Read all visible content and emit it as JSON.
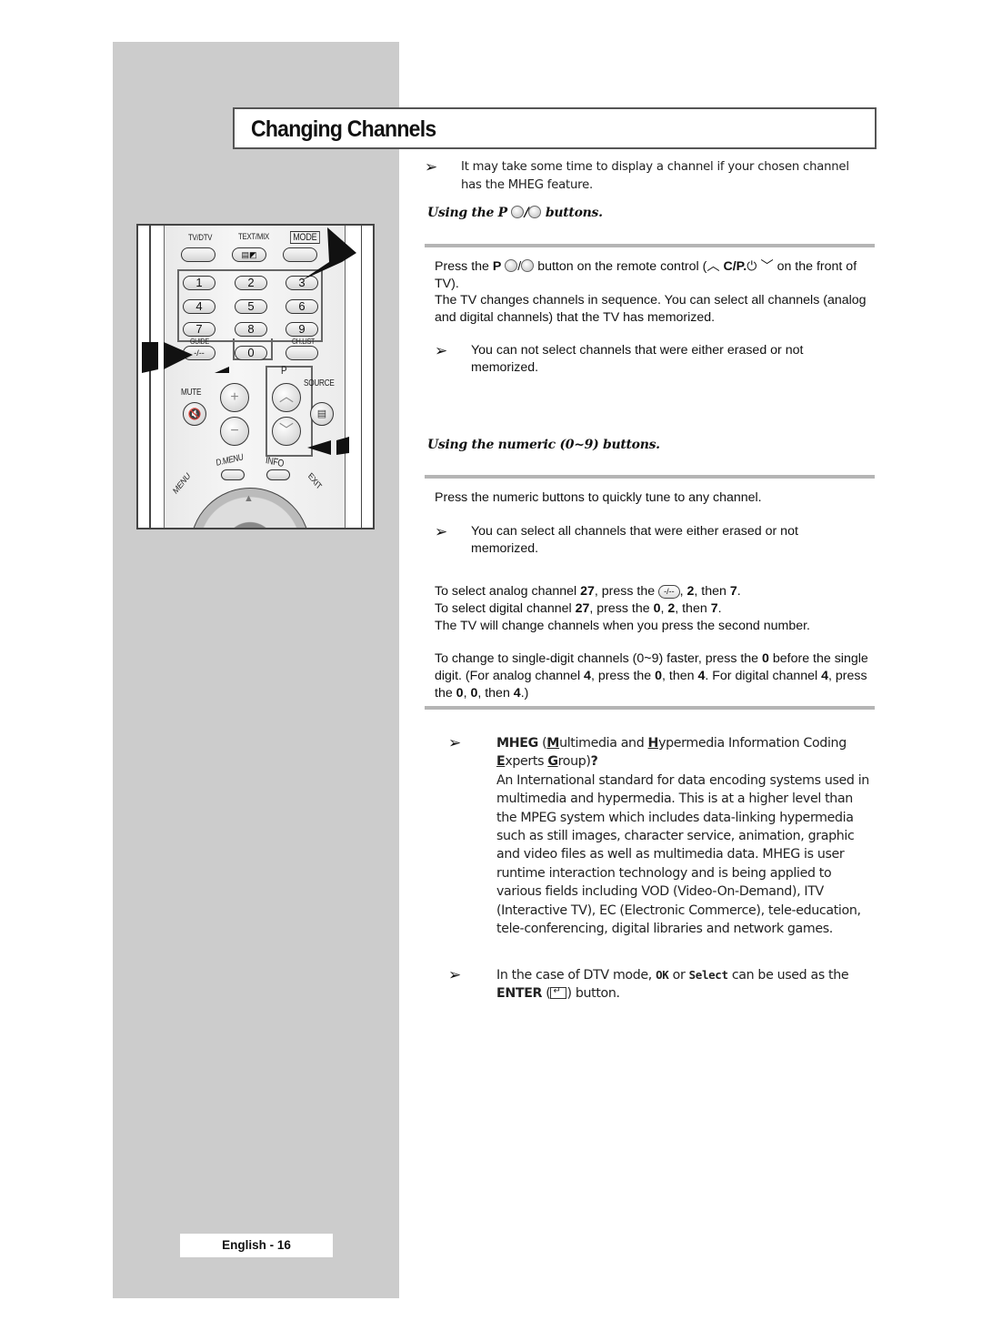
{
  "page": {
    "title": "Changing Channels",
    "footer": "English - 16"
  },
  "remote": {
    "labels": {
      "tv_dtv": "TV/DTV",
      "text_mix": "TEXT/MIX",
      "mode": "MODE",
      "guide": "GUIDE",
      "ch_list": "CH.LIST",
      "mute": "MUTE",
      "p": "P",
      "source": "SOURCE",
      "d_menu": "D.MENU",
      "info": "INFO",
      "menu": "MENU",
      "exit": "EXIT"
    },
    "numeric_keys": [
      "1",
      "2",
      "3",
      "4",
      "5",
      "6",
      "7",
      "8",
      "9"
    ],
    "zero_key": "0",
    "dash_key": "-/--",
    "vol_up": "+",
    "vol_down": "−",
    "ch_up": "︿",
    "ch_down": "﹀",
    "up_arrow": "▲"
  },
  "intro_note": "It may take some time to display a channel if your chosen channel has the MHEG feature.",
  "section1": {
    "heading_prefix": "Using the P",
    "heading_sep": "/",
    "heading_suffix": "buttons.",
    "para1_a": "Press the ",
    "para1_b": "P",
    "para1_c": "/",
    "para1_d": " button on the remote control (",
    "para1_e": "︿",
    "para1_f": " C/P.",
    "para1_g": "⏻",
    "para1_h": "﹀",
    "para1_i": " on the front of TV).",
    "para2": "The TV changes channels in sequence. You can select all channels (analog and digital channels) that the TV has memorized.",
    "note": "You can not select channels that were either erased or not memorized."
  },
  "section2": {
    "heading": "Using the numeric (0~9) buttons.",
    "para1": "Press the numeric buttons to quickly tune to any channel.",
    "note": "You can select all channels that were either erased or not memorized.",
    "analog_a": "To select analog channel ",
    "analog_b": "27",
    "analog_c": ", press the ",
    "analog_key": "-/--",
    "analog_d": ", ",
    "analog_e": "2",
    "analog_f": ", then ",
    "analog_g": "7",
    "analog_h": ".",
    "digital_a": "To select digital channel ",
    "digital_b": "27",
    "digital_c": ", press the ",
    "digital_d": "0",
    "digital_e": ", ",
    "digital_f": "2",
    "digital_g": ", then ",
    "digital_h": "7",
    "digital_i": ".",
    "second_number": "The TV will change channels when you press the second number.",
    "single_a": "To change to single-digit channels (0~9) faster, press the ",
    "single_b": "0",
    "single_c": " before the single digit. (For analog channel ",
    "single_d": "4",
    "single_e": ", press the ",
    "single_f": "0",
    "single_g": ", then ",
    "single_h": "4",
    "single_i": ". For digital channel ",
    "single_j": "4",
    "single_k": ", press the ",
    "single_l": "0",
    "single_m": ", ",
    "single_n": "0",
    "single_o": ", then ",
    "single_p": "4",
    "single_q": ".)"
  },
  "mheg_note": {
    "title_bold": "MHEG",
    "t1": " (",
    "u1": "M",
    "t2": "ultimedia and ",
    "u2": "H",
    "t3": "ypermedia Information Coding ",
    "u3": "E",
    "t4": "xperts ",
    "u4": "G",
    "t5": "roup)",
    "q": "?",
    "body": "An International standard for data encoding systems used in multimedia and hypermedia. This is at a higher level than the MPEG system which includes data-linking hypermedia such as still images, character service, animation, graphic and video files as well as multimedia data. MHEG is user runtime interaction technology and is being applied to various fields including VOD (Video-On-Demand), ITV (Interactive TV), EC (Electronic Commerce), tele-education, tele-conferencing, digital libraries and network games."
  },
  "dtv_note": {
    "a": "In the case of DTV mode, ",
    "ok": "OK",
    "b": " or ",
    "select": "Select",
    "c": " can be used as the ",
    "enter": "ENTER",
    "d": " (",
    "e": ") button."
  },
  "note_arrow_glyph": "➢"
}
